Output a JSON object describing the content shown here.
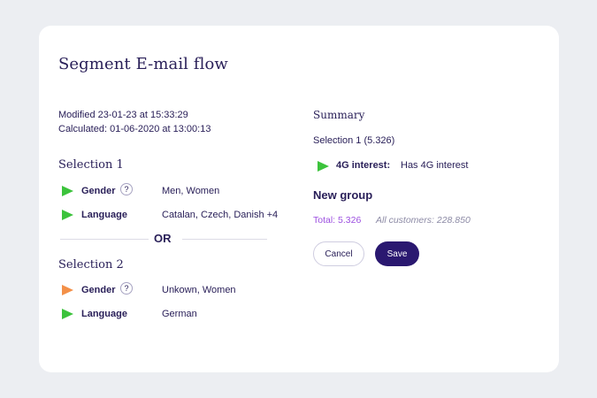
{
  "page": {
    "title": "Segment E-mail flow",
    "modified": "Modified 23-01-23 at 15:33:29",
    "calculated": "Calculated: 01-06-2020 at 13:00:13"
  },
  "selection1": {
    "title": "Selection 1",
    "rows": [
      {
        "label": "Gender",
        "help": "?",
        "value": "Men, Women",
        "status": "green"
      },
      {
        "label": "Language",
        "value": "Catalan, Czech, Danish +4",
        "status": "green"
      }
    ]
  },
  "separator": {
    "label": "OR"
  },
  "selection2": {
    "title": "Selection 2",
    "rows": [
      {
        "label": "Gender",
        "help": "?",
        "value": "Unkown, Women",
        "status": "orange"
      },
      {
        "label": "Language",
        "value": "German",
        "status": "green"
      }
    ]
  },
  "summary": {
    "title": "Summary",
    "selection": "Selection 1 (5.326)",
    "interest_label": "4G interest:",
    "interest_value": "Has 4G interest"
  },
  "new_group": {
    "title": "New group",
    "total": "Total: 5.326",
    "all_customers": "All customers: 228.850"
  },
  "actions": {
    "cancel_label": "Cancel",
    "save_label": "Save"
  },
  "colors": {
    "primary": "#2a1870",
    "green": "#3cc33c",
    "orange": "#f39048",
    "accent_purple": "#9c4fe0"
  },
  "icons": {
    "status": "play-triangle-icon",
    "help": "question-icon"
  }
}
